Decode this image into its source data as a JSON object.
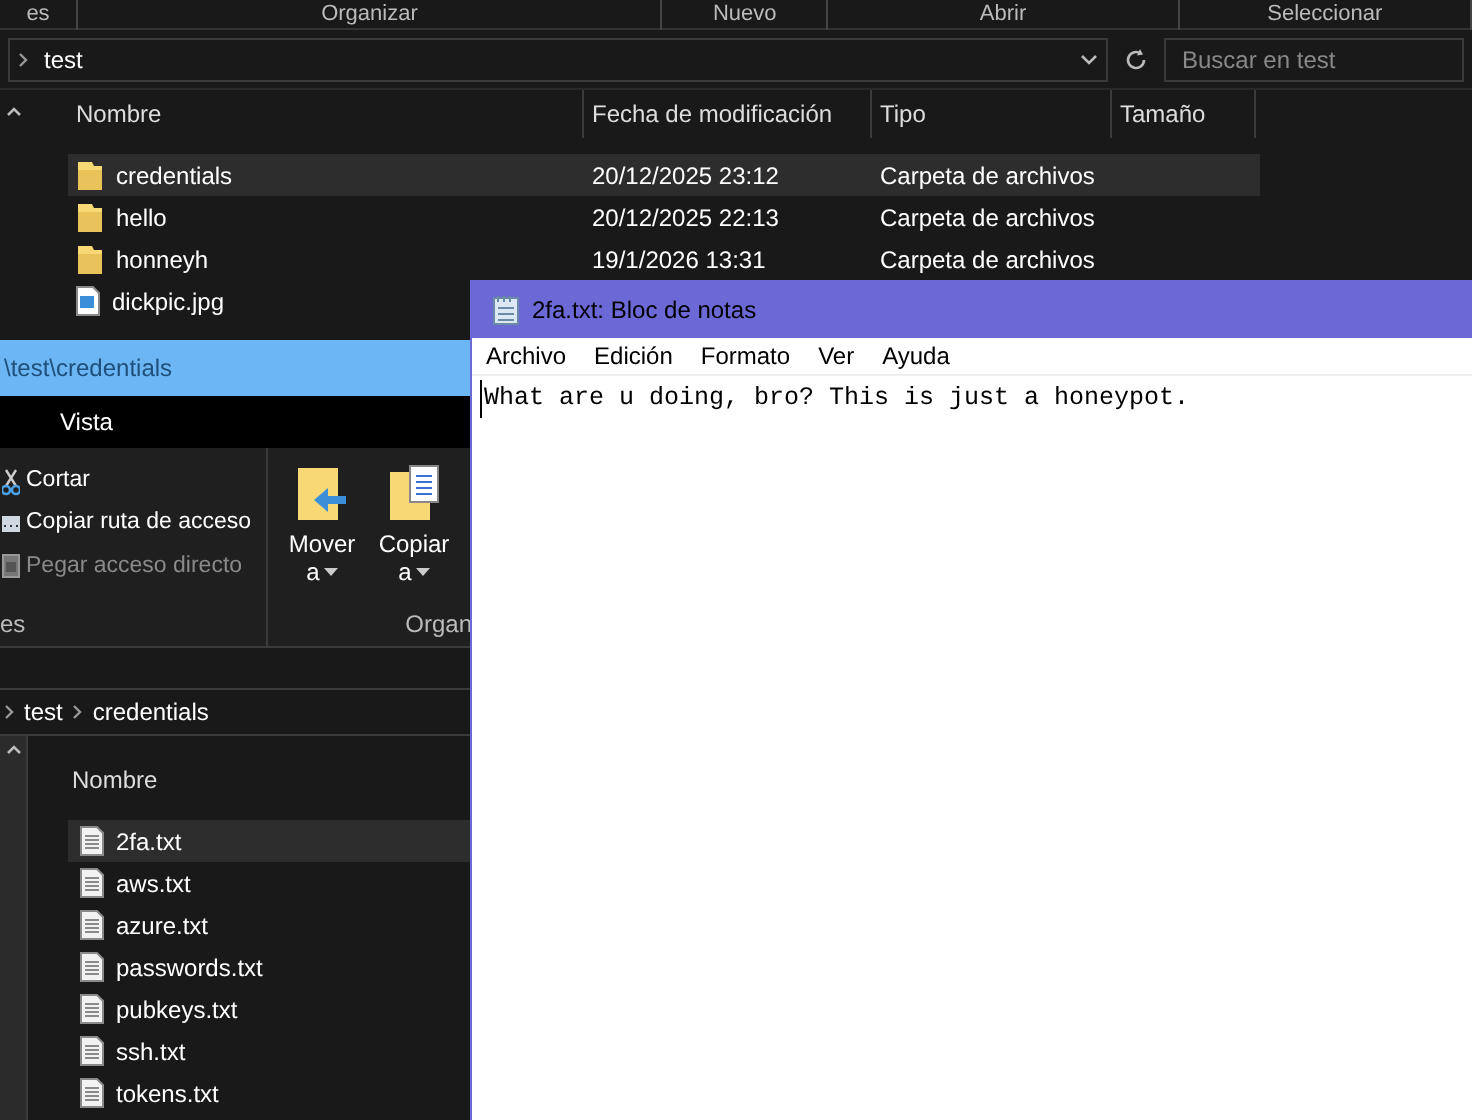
{
  "back_explorer": {
    "ribbon_groups": [
      "es",
      "Organizar",
      "Nuevo",
      "Abrir",
      "Seleccionar"
    ],
    "address": {
      "path": "test"
    },
    "search": {
      "placeholder": "Buscar en test"
    },
    "columns": [
      "Nombre",
      "Fecha de modificación",
      "Tipo",
      "Tamaño"
    ],
    "rows": [
      {
        "kind": "folder",
        "name": "credentials",
        "date": "20/12/2025 23:12",
        "type": "Carpeta de archivos",
        "selected": true
      },
      {
        "kind": "folder",
        "name": "hello",
        "date": "20/12/2025 22:13",
        "type": "Carpeta de archivos",
        "selected": false
      },
      {
        "kind": "folder",
        "name": "honneyh",
        "date": "19/1/2026 13:31",
        "type": "Carpeta de archivos",
        "selected": false
      },
      {
        "kind": "image",
        "name": "dickpic.jpg",
        "selected": false
      }
    ]
  },
  "front_explorer": {
    "title": "\\test\\credentials",
    "tabs": [
      "Vista"
    ],
    "clipboard": [
      {
        "kind": "cut",
        "label": "Cortar",
        "disabled": false
      },
      {
        "kind": "path",
        "label": "Copiar ruta de acceso",
        "disabled": false
      },
      {
        "kind": "shortcut",
        "label": "Pegar acceso directo",
        "disabled": true
      }
    ],
    "organize": [
      {
        "kind": "move",
        "label": "Mover",
        "sub": "a"
      },
      {
        "kind": "copy",
        "label": "Copiar",
        "sub": "a"
      }
    ],
    "group_labels": [
      "es",
      "Organ"
    ],
    "breadcrumb": [
      "test",
      "credentials"
    ],
    "column": "Nombre",
    "files": [
      {
        "name": "2fa.txt",
        "selected": true
      },
      {
        "name": "aws.txt",
        "selected": false
      },
      {
        "name": "azure.txt",
        "selected": false
      },
      {
        "name": "passwords.txt",
        "selected": false
      },
      {
        "name": "pubkeys.txt",
        "selected": false
      },
      {
        "name": "ssh.txt",
        "selected": false
      },
      {
        "name": "tokens.txt",
        "selected": false
      }
    ]
  },
  "notepad": {
    "title": "2fa.txt: Bloc de notas",
    "menu": [
      "Archivo",
      "Edición",
      "Formato",
      "Ver",
      "Ayuda"
    ],
    "text": "What are u doing, bro? This is just a honeypot."
  }
}
